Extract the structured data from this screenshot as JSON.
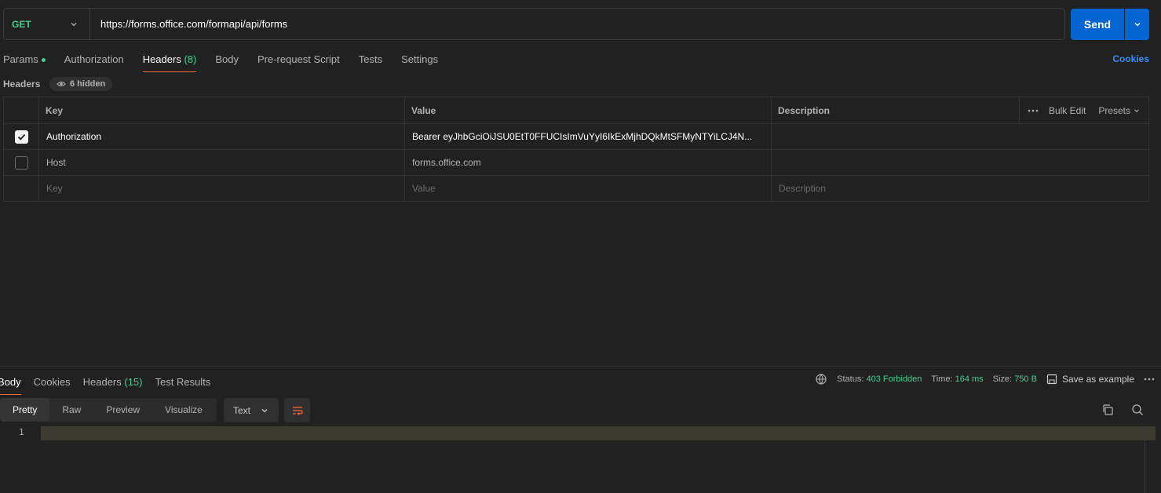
{
  "request": {
    "method": "GET",
    "url": "https://forms.office.com/formapi/api/forms",
    "send_label": "Send"
  },
  "request_tabs": [
    {
      "label": "Params"
    },
    {
      "label": "Authorization"
    },
    {
      "label": "Headers",
      "count": "(8)"
    },
    {
      "label": "Body"
    },
    {
      "label": "Pre-request Script"
    },
    {
      "label": "Tests"
    },
    {
      "label": "Settings"
    }
  ],
  "cookies_label": "Cookies",
  "headers_section": {
    "label": "Headers",
    "hidden_badge": "6 hidden",
    "columns": {
      "key": "Key",
      "value": "Value",
      "description": "Description"
    },
    "bulk_edit": "Bulk Edit",
    "presets": "Presets",
    "rows": [
      {
        "checked": true,
        "key": "Authorization",
        "value": "Bearer eyJhbGciOiJSU0EtT0FFUCIsImVuYyI6IkExMjhDQkMtSFMyNTYiLCJ4N...",
        "description": ""
      },
      {
        "checked": false,
        "key": "Host",
        "value": "forms.office.com",
        "description": ""
      }
    ],
    "placeholders": {
      "key": "Key",
      "value": "Value",
      "description": "Description"
    }
  },
  "response": {
    "tabs": [
      {
        "label": "Body"
      },
      {
        "label": "Cookies"
      },
      {
        "label": "Headers",
        "count": "(15)"
      },
      {
        "label": "Test Results"
      }
    ],
    "status_label": "Status:",
    "status_value": "403 Forbidden",
    "time_label": "Time:",
    "time_value": "164 ms",
    "size_label": "Size:",
    "size_value": "750 B",
    "save_example": "Save as example",
    "view_modes": [
      "Pretty",
      "Raw",
      "Preview",
      "Visualize"
    ],
    "format": "Text",
    "line_number": "1"
  },
  "colors": {
    "accent_blue": "#0265d2",
    "success_green": "#49cc90",
    "tab_underline": "#f26b3a"
  }
}
